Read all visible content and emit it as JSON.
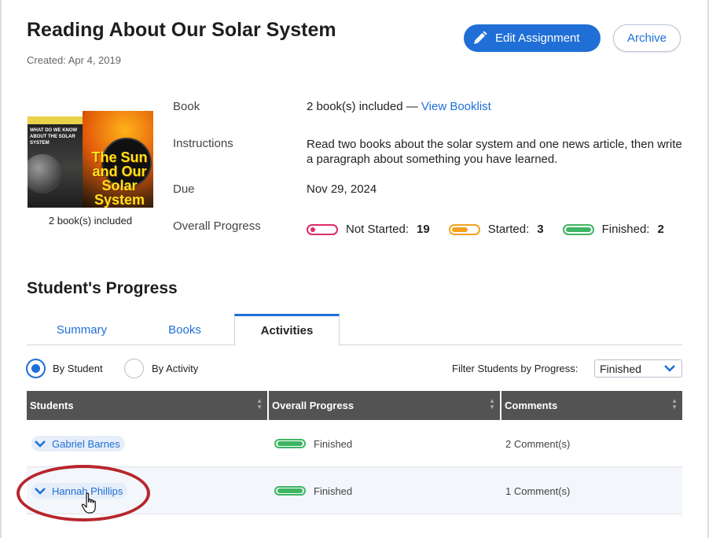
{
  "assignment": {
    "title": "Reading About Our Solar System",
    "created": "Created: Apr 4, 2019",
    "edit_label": "Edit Assignment",
    "archive_label": "Archive"
  },
  "books": {
    "caption": "2 book(s) included",
    "cover1_text": "WHAT DO WE KNOW ABOUT THE SOLAR SYSTEM",
    "cover2_text": "The Sun and Our Solar System"
  },
  "details": {
    "book_label": "Book",
    "book_value": "2 book(s) included — ",
    "booklist_link": "View Booklist",
    "instructions_label": "Instructions",
    "instructions_value": "Read two books about the solar system and one news article, then write a paragraph about something you have learned.",
    "due_label": "Due",
    "due_value": "Nov 29, 2024",
    "progress_label": "Overall Progress",
    "not_started_label": "Not Started:",
    "not_started_count": "19",
    "started_label": "Started:",
    "started_count": "3",
    "finished_label": "Finished:",
    "finished_count": "2"
  },
  "progress": {
    "section_title": "Student's Progress",
    "tabs": [
      {
        "label": "Summary"
      },
      {
        "label": "Books"
      },
      {
        "label": "Activities"
      }
    ],
    "view_options": [
      {
        "label": "By Student"
      },
      {
        "label": "By Activity"
      }
    ],
    "filter_label": "Filter Students by Progress:",
    "filter_value": "Finished"
  },
  "table": {
    "headers": [
      "Students",
      "Overall Progress",
      "Comments"
    ],
    "rows": [
      {
        "student": "Gabriel Barnes",
        "progress": "Finished",
        "comments": "2 Comment(s)"
      },
      {
        "student": "Hannah Phillips",
        "progress": "Finished",
        "comments": "1 Comment(s)"
      }
    ]
  },
  "colors": {
    "accent": "#1f6fd6",
    "not_started": "#e0296a",
    "started": "#f3a21b",
    "finished": "#3eb562",
    "table_header": "#535353",
    "highlight": "#b7262d"
  }
}
